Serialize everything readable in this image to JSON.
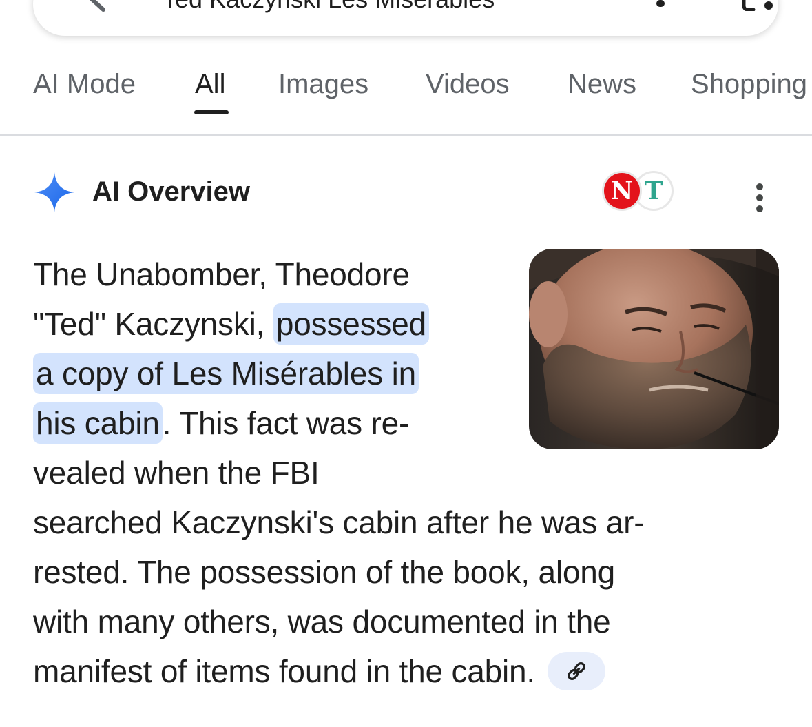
{
  "search": {
    "query": "Ted Kaczynski Les Misérables"
  },
  "tabs": [
    {
      "label": "AI Mode",
      "active": false
    },
    {
      "label": "All",
      "active": true
    },
    {
      "label": "Images",
      "active": false
    },
    {
      "label": "Videos",
      "active": false
    },
    {
      "label": "News",
      "active": false
    },
    {
      "label": "Shopping",
      "active": false
    }
  ],
  "ai_overview": {
    "title": "AI Overview",
    "source_badges": [
      {
        "letter": "N",
        "color": "#e3131b"
      },
      {
        "letter": "T",
        "color": "#2fa58e"
      }
    ],
    "answer": {
      "line1": "The Unabomber, Theodore",
      "line2_pre": "\"Ted\" Kaczynski, ",
      "highlight_a": "possessed",
      "highlight_b": "a copy of Les Misérables in",
      "highlight_c": "his cabin",
      "line4_post": ". This fact was re-",
      "line5": "vealed when the FBI",
      "line6": "searched Kaczynski's cabin after he was ar-",
      "line7": "rested. The possession of the book, along",
      "line8": "with many others, was documented in the",
      "line9": "manifest of items found in the cabin."
    },
    "image_alt": "Photo of Ted Kaczynski",
    "icons": {
      "sparkle": "ai-sparkle-icon",
      "more": "more-vert-icon",
      "link": "link-icon"
    },
    "colors": {
      "highlight": "#d3e3fd",
      "sparkle": "#3b82f6"
    }
  }
}
